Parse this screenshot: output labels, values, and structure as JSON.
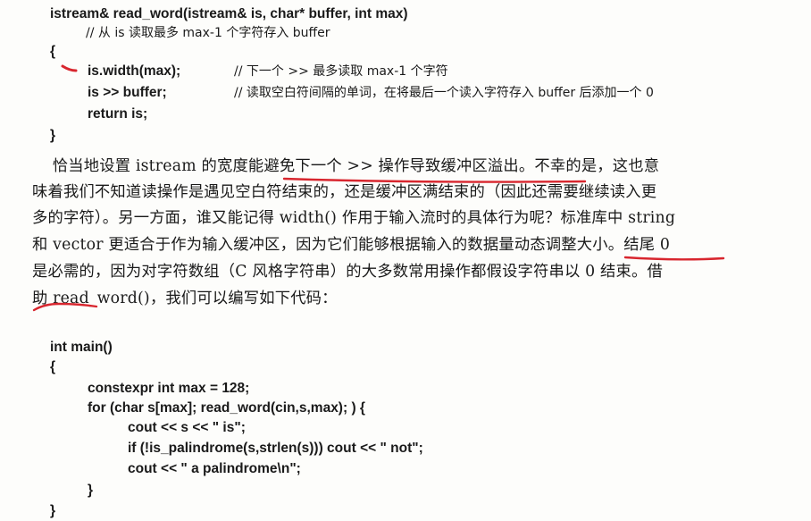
{
  "code1": {
    "sig": "istream& read_word(istream& is, char* buffer, int max)",
    "doc_comment": "// 从 is 读取最多 max-1 个字符存入 buffer",
    "open": "{",
    "l1_code": "is.width(max);",
    "l1_comment": "// 下一个 >> 最多读取 max-1 个字符",
    "l2_code": "is >> buffer;",
    "l2_comment": "// 读取空白符间隔的单词，在将最后一个读入字符存入 buffer 后添加一个 0",
    "l3_code": "return is;",
    "close": "}"
  },
  "prose": {
    "line1": "    恰当地设置 istream 的宽度能避免下一个 >> 操作导致缓冲区溢出。不幸的是，这也意",
    "line2": "味着我们不知道读操作是遇见空白符结束的，还是缓冲区满结束的（因此还需要继续读入更",
    "line3": "多的字符）。另一方面，谁又能记得 width() 作用于输入流时的具体行为呢？标准库中 string",
    "line4": "和 vector 更适合于作为输入缓冲区，因为它们能够根据输入的数据量动态调整大小。结尾 0",
    "line5": "是必需的，因为对字符数组（C 风格字符串）的大多数常用操作都假设字符串以 0 结束。借",
    "line6": "助 read_word()，我们可以编写如下代码："
  },
  "code2": {
    "l1": "int main()",
    "l2": "{",
    "l3": "constexpr int max = 128;",
    "l4": "for (char s[max]; read_word(cin,s,max); ) {",
    "l5": "cout << s << \" is\";",
    "l6": "if (!is_palindrome(s,strlen(s))) cout << \" not\";",
    "l7": "cout << \" a palindrome\\n\";",
    "l8": "}",
    "l9": "}"
  },
  "colors": {
    "ink": "#1a1a1a",
    "pen": "#d8262e",
    "paper": "#fdfdfb"
  }
}
